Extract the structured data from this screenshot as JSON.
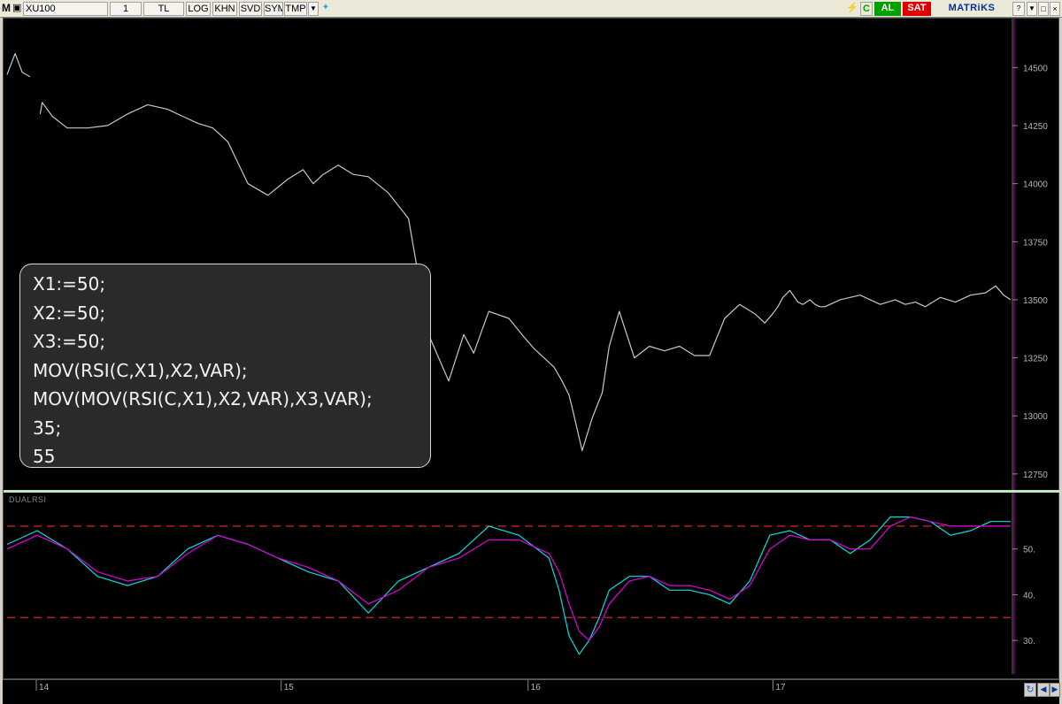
{
  "toolbar": {
    "logo": "M",
    "symbol": "XU100",
    "period": "1",
    "currency": "TL",
    "buttons": [
      "LOG",
      "KHN",
      "SVD",
      "SYM",
      "TMP"
    ],
    "connection_label": "C",
    "buy_label": "AL",
    "sell_label": "SAT",
    "brand": "MATRiKS",
    "colors": {
      "buy": "#00a000",
      "sell": "#e00000",
      "brand": "#003399"
    }
  },
  "formula": {
    "lines": [
      "X1:=50;",
      "X2:=50;",
      "X3:=50;",
      "MOV(RSI(C,X1),X2,VAR);",
      "MOV(MOV(RSI(C,X1),X2,VAR),X3,VAR);",
      "35;",
      "55"
    ]
  },
  "indicator": {
    "name": "DUALRSI"
  },
  "chart_data": [
    {
      "type": "line",
      "title": "",
      "x": [
        0,
        10,
        20,
        30,
        40,
        50,
        60,
        70,
        80,
        90,
        100
      ],
      "x_tick_labels": [
        "14",
        "15",
        "16",
        "17"
      ],
      "ylim": [
        12700,
        14650
      ],
      "y_ticks": [
        12750,
        13000,
        13250,
        13500,
        13750,
        14000,
        14250,
        14500
      ],
      "grid": false,
      "series": [
        {
          "color": "#c8c8c8",
          "x": [
            0,
            0.8,
            1.5,
            2.3,
            3,
            3.3,
            3.5,
            4.5,
            6,
            8,
            10,
            12,
            14,
            16,
            17.5,
            19,
            20.5,
            22,
            24,
            26,
            28,
            29.5,
            30.5,
            31.5,
            33,
            34.5,
            36,
            38,
            40,
            42,
            44,
            45.5,
            46.5,
            48,
            50,
            51.5,
            52.5,
            53.5,
            54.5,
            55.3,
            56,
            56.5,
            57.3,
            58.3,
            59.3,
            60,
            61,
            62.5,
            64,
            65.5,
            67,
            68.5,
            70,
            71.5,
            73,
            74.5,
            75.5,
            76.3,
            76.8,
            77.3,
            78,
            78.8,
            79.3,
            80,
            80.5,
            81,
            81.5,
            82,
            83,
            85,
            87,
            88.5,
            89.5,
            90.5,
            91.5,
            93,
            94.5,
            96,
            97.5,
            98.5,
            99.3,
            100
          ],
          "values": [
            14470,
            14560,
            14480,
            14460,
            null,
            14300,
            14350,
            14290,
            14240,
            14240,
            14250,
            14300,
            14340,
            14320,
            14290,
            14260,
            14240,
            14180,
            14000,
            13950,
            14020,
            14060,
            14000,
            14040,
            14080,
            14040,
            14030,
            13960,
            13850,
            13350,
            13150,
            13350,
            13270,
            13450,
            13420,
            13340,
            13290,
            13250,
            13210,
            13150,
            13090,
            13000,
            12850,
            12990,
            13100,
            13300,
            13450,
            13250,
            13300,
            13280,
            13300,
            13260,
            13260,
            13420,
            13480,
            13440,
            13400,
            13440,
            13470,
            13510,
            13540,
            13490,
            13480,
            13500,
            13480,
            13470,
            13470,
            13480,
            13500,
            13520,
            13480,
            13500,
            13480,
            13490,
            13470,
            13510,
            13490,
            13520,
            13530,
            13560,
            13520,
            13500
          ]
        }
      ]
    },
    {
      "type": "line",
      "title": "DUALRSI",
      "ylim": [
        25,
        60
      ],
      "y_ticks": [
        30,
        40,
        50
      ],
      "y_tick_labels": [
        "30.",
        "40.",
        "50."
      ],
      "grid": false,
      "series": [
        {
          "color": "#00e0e0",
          "x": [
            0,
            3,
            6,
            9,
            12,
            15,
            18,
            21,
            24,
            27,
            30,
            33,
            36,
            39,
            42,
            45,
            48,
            51,
            54,
            55,
            56,
            57,
            58,
            59,
            60,
            62,
            64,
            66,
            68,
            70,
            72,
            74,
            76,
            78,
            80,
            82,
            84,
            86,
            88,
            90,
            92,
            94,
            96,
            97,
            98,
            100
          ],
          "values": [
            51,
            54,
            50,
            44,
            42,
            44,
            50,
            53,
            51,
            48,
            45,
            43,
            36,
            43,
            46,
            49,
            55,
            53,
            48,
            41,
            31,
            27,
            30,
            35,
            41,
            44,
            44,
            41,
            41,
            40,
            38,
            43,
            53,
            54,
            52,
            52,
            49,
            52,
            57,
            57,
            56,
            53,
            54,
            55,
            56,
            56
          ]
        },
        {
          "color": "#e000e0",
          "x": [
            0,
            3,
            6,
            9,
            12,
            15,
            18,
            21,
            24,
            27,
            30,
            33,
            36,
            39,
            42,
            45,
            48,
            51,
            54,
            55,
            56,
            57,
            58,
            59,
            60,
            62,
            64,
            66,
            68,
            70,
            72,
            74,
            76,
            78,
            80,
            82,
            84,
            86,
            88,
            90,
            92,
            94,
            96,
            97,
            98,
            100
          ],
          "values": [
            50,
            53,
            50,
            45,
            43,
            44,
            49,
            53,
            51,
            48,
            46,
            43,
            38,
            41,
            46,
            48,
            52,
            52,
            49,
            45,
            38,
            32,
            30,
            33,
            38,
            43,
            44,
            42,
            42,
            41,
            39,
            42,
            50,
            53,
            52,
            52,
            50,
            50,
            55,
            57,
            56,
            55,
            55,
            55,
            55,
            55
          ]
        }
      ],
      "reference_lines": [
        {
          "value": 55,
          "color": "#e02020",
          "style": "dashed"
        },
        {
          "value": 35,
          "color": "#e02020",
          "style": "dashed"
        }
      ]
    }
  ]
}
